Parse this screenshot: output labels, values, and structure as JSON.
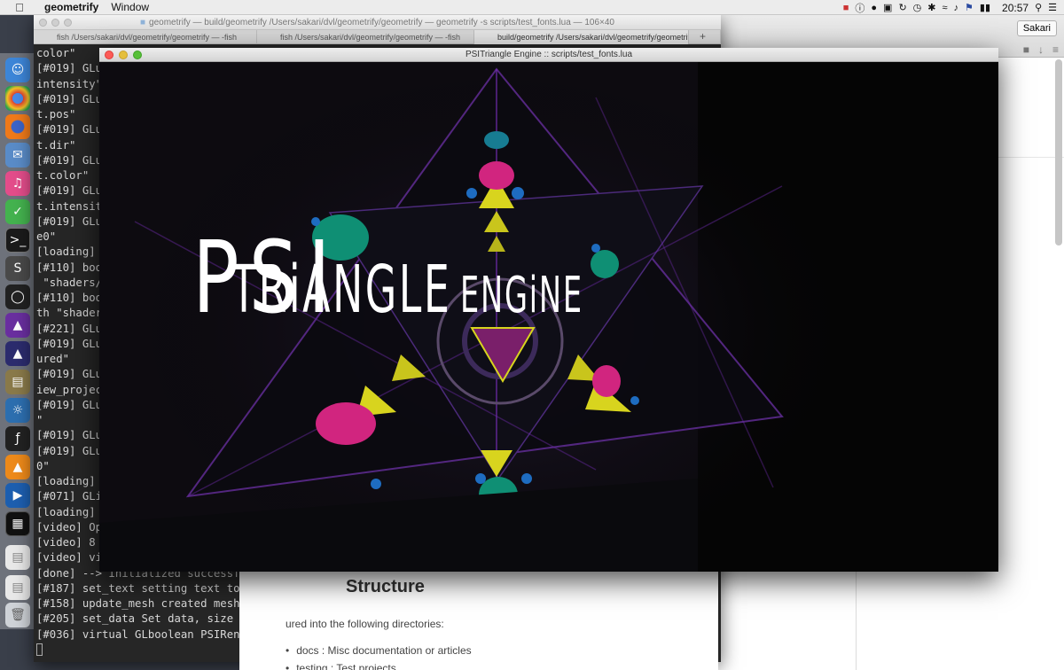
{
  "menubar": {
    "app_name": "geometrify",
    "menus": [
      "Window"
    ],
    "clock": "20:57"
  },
  "terminal": {
    "title": "geometrify — build/geometrify  /Users/sakari/dvl/geometrify/geometrify — geometrify -s scripts/test_fonts.lua — 106×40",
    "tabs": [
      "fish  /Users/sakari/dvl/geometrify/geometrify — -fish",
      "fish  /Users/sakari/dvl/geometrify/geometrify — -fish",
      "build/geometrify  /Users/sakari/dvl/geometrify/geometrif..."
    ],
    "add_tab": "+",
    "lines": [
      "color\"",
      "[#019] GLu",
      "intensity\"",
      "[#019] GLu",
      "t.pos\"",
      "[#019] GLu",
      "t.dir\"",
      "[#019] GLu",
      "t.color\"",
      "[#019] GLu",
      "t.intensit",
      "[#019] GLu",
      "e0\"",
      "[loading]",
      "[#110] boo",
      " \"shaders/",
      "[#110] boo",
      "th \"shader",
      "[#221] GLu",
      "[#019] GLu",
      "ured\"",
      "[#019] GLu",
      "iew_projec",
      "[#019] GLu",
      "\"",
      "[#019] GLu",
      "[#019] GLu",
      "0\"",
      "[loading]",
      "[#071] GLi",
      "[loading]",
      "[video] Op",
      "[video] 8",
      "[video] vi",
      "[done] --> initialized successfully !",
      "[#187] set_text setting text to PSITRiANGLE ENGiNE",
      "[#158] update_mesh created mesh, _text = PSITRiANGLE ENGiNE",
      "[#205] set_data Set data, size = 0.000000.0.000000",
      "[#036] virtual GLboolean PSIRenderMesh::init() Initialized PSIRenderMesh"
    ]
  },
  "game_window": {
    "title": "PSITriangle Engine :: scripts/test_fonts.lua",
    "logo": {
      "part1": "PSI",
      "part2": "TRiANGLE",
      "part3": "ENGiNE"
    }
  },
  "browser": {
    "user_button": "Sakari"
  },
  "doc": {
    "heading": "Structure",
    "paragraph": "ured into the following directories:",
    "items": [
      "docs : Misc documentation or articles",
      "testing : Test projects"
    ]
  },
  "colors": {
    "traffic_red": "#fc5b57",
    "traffic_yellow": "#e5bf3c",
    "traffic_green": "#57c038",
    "neon_purple": "#7b2fbf",
    "teal": "#0f8f74",
    "magenta": "#d1257f",
    "yellow": "#d8d41e"
  }
}
